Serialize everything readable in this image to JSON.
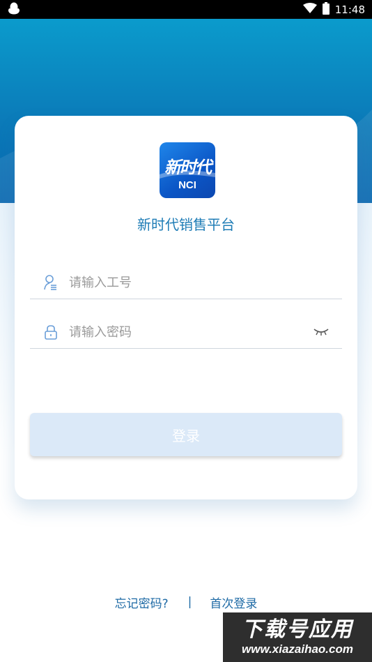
{
  "status_bar": {
    "time": "11:48",
    "notification_icon": "qq-penguin-icon",
    "wifi_icon": "wifi-icon",
    "battery_icon": "battery-icon"
  },
  "app": {
    "logo_text": "新时代",
    "logo_subtext": "NCI",
    "name": "新时代销售平台"
  },
  "form": {
    "employee_id": {
      "placeholder": "请输入工号",
      "value": "",
      "icon": "user-icon"
    },
    "password": {
      "placeholder": "请输入密码",
      "value": "",
      "icon": "lock-icon",
      "toggle_icon": "eye-closed-icon"
    },
    "login_label": "登录"
  },
  "links": {
    "forgot_password": "忘记密码?",
    "separator": "|",
    "first_login": "首次登录"
  },
  "watermark": {
    "title": "下载号应用",
    "url": "www.xiazaihao.com"
  },
  "colors": {
    "header_gradient_top": "#0b9bcc",
    "header_gradient_bottom": "#0867b0",
    "accent": "#1e7cb6",
    "button_disabled": "#dbe9f8"
  }
}
